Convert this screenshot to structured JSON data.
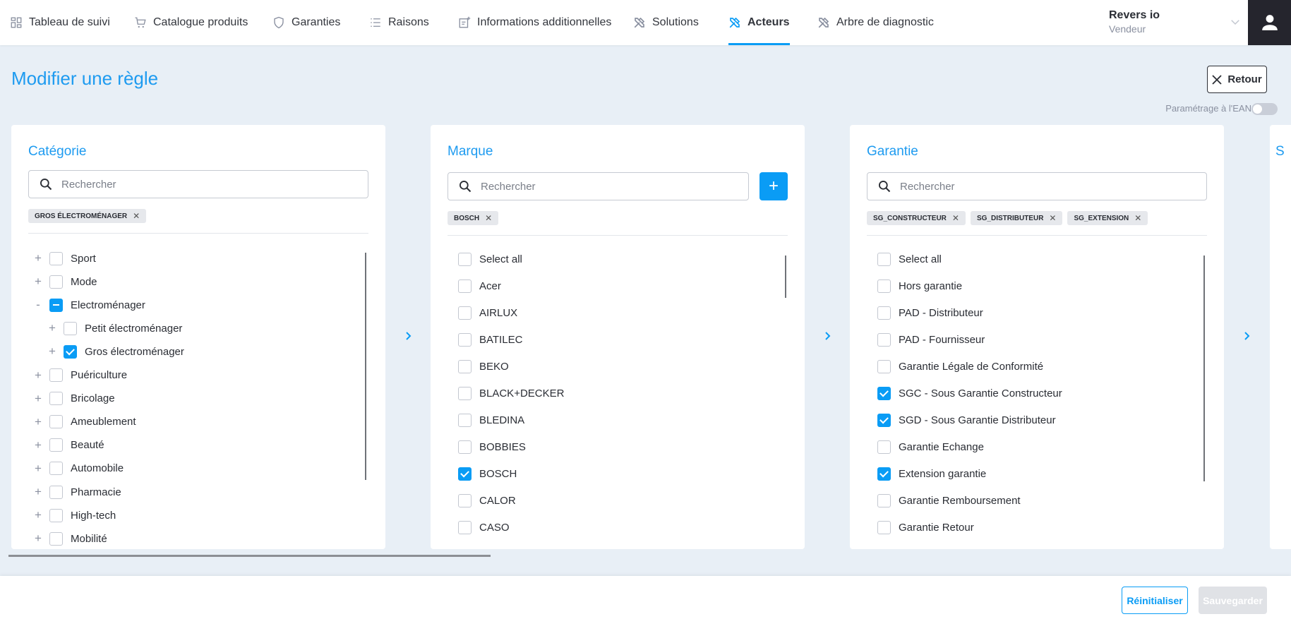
{
  "colors": {
    "accent": "#0a9cf5",
    "title": "#1e9bf0",
    "avatar_bg": "#25252d"
  },
  "nav": {
    "items": [
      {
        "label": "Tableau de suivi",
        "icon": "dashboard-icon"
      },
      {
        "label": "Catalogue produits",
        "icon": "cart-icon"
      },
      {
        "label": "Garanties",
        "icon": "shield-icon"
      },
      {
        "label": "Raisons",
        "icon": "list-icon"
      },
      {
        "label": "Informations additionnelles",
        "icon": "note-add-icon"
      },
      {
        "label": "Solutions",
        "icon": "tools-icon"
      },
      {
        "label": "Acteurs",
        "icon": "tools-icon",
        "active": true
      },
      {
        "label": "Arbre de diagnostic",
        "icon": "tools-icon"
      }
    ]
  },
  "user": {
    "name": "Revers io",
    "role": "Vendeur"
  },
  "page": {
    "title": "Modifier une règle",
    "back_label": "Retour",
    "ean_label": "Paramétrage à l'EAN",
    "ean_enabled": false
  },
  "cards": [
    {
      "title": "Catégorie",
      "search_placeholder": "Rechercher",
      "chips": [
        "GROS ÉLECTROMÉNAGER"
      ],
      "items": [
        {
          "label": "Sport",
          "state": "unchecked",
          "level": 0,
          "expander": "+"
        },
        {
          "label": "Mode",
          "state": "unchecked",
          "level": 0,
          "expander": "+"
        },
        {
          "label": "Electroménager",
          "state": "indeterminate",
          "level": 0,
          "expander": "-"
        },
        {
          "label": "Petit électroménager",
          "state": "unchecked",
          "level": 1,
          "expander": "+"
        },
        {
          "label": "Gros électroménager",
          "state": "checked",
          "level": 1,
          "expander": "+"
        },
        {
          "label": "Puériculture",
          "state": "unchecked",
          "level": 0,
          "expander": "+"
        },
        {
          "label": "Bricolage",
          "state": "unchecked",
          "level": 0,
          "expander": "+"
        },
        {
          "label": "Ameublement",
          "state": "unchecked",
          "level": 0,
          "expander": "+"
        },
        {
          "label": "Beauté",
          "state": "unchecked",
          "level": 0,
          "expander": "+"
        },
        {
          "label": "Automobile",
          "state": "unchecked",
          "level": 0,
          "expander": "+"
        },
        {
          "label": "Pharmacie",
          "state": "unchecked",
          "level": 0,
          "expander": "+"
        },
        {
          "label": "High-tech",
          "state": "unchecked",
          "level": 0,
          "expander": "+"
        },
        {
          "label": "Mobilité",
          "state": "unchecked",
          "level": 0,
          "expander": "+"
        }
      ]
    },
    {
      "title": "Marque",
      "search_placeholder": "Rechercher",
      "add_label": "+",
      "chips": [
        "BOSCH"
      ],
      "items": [
        {
          "label": "Select all",
          "state": "unchecked"
        },
        {
          "label": "Acer",
          "state": "unchecked"
        },
        {
          "label": "AIRLUX",
          "state": "unchecked"
        },
        {
          "label": "BATILEC",
          "state": "unchecked"
        },
        {
          "label": "BEKO",
          "state": "unchecked"
        },
        {
          "label": "BLACK+DECKER",
          "state": "unchecked"
        },
        {
          "label": "BLEDINA",
          "state": "unchecked"
        },
        {
          "label": "BOBBIES",
          "state": "unchecked"
        },
        {
          "label": "BOSCH",
          "state": "checked"
        },
        {
          "label": "CALOR",
          "state": "unchecked"
        },
        {
          "label": "CASO",
          "state": "unchecked"
        }
      ]
    },
    {
      "title": "Garantie",
      "search_placeholder": "Rechercher",
      "chips": [
        "SG_CONSTRUCTEUR",
        "SG_DISTRIBUTEUR",
        "SG_EXTENSION"
      ],
      "items": [
        {
          "label": "Select all",
          "state": "unchecked"
        },
        {
          "label": "Hors garantie",
          "state": "unchecked"
        },
        {
          "label": "PAD - Distributeur",
          "state": "unchecked"
        },
        {
          "label": "PAD - Fournisseur",
          "state": "unchecked"
        },
        {
          "label": "Garantie Légale de Conformité",
          "state": "unchecked"
        },
        {
          "label": "SGC - Sous Garantie Constructeur",
          "state": "checked"
        },
        {
          "label": "SGD - Sous Garantie Distributeur",
          "state": "checked"
        },
        {
          "label": "Garantie Echange",
          "state": "unchecked"
        },
        {
          "label": "Extension garantie",
          "state": "checked"
        },
        {
          "label": "Garantie Remboursement",
          "state": "unchecked"
        },
        {
          "label": "Garantie Retour",
          "state": "unchecked"
        }
      ]
    },
    {
      "title": "S"
    }
  ],
  "footer": {
    "reset_label": "Réinitialiser",
    "save_label": "Sauvegarder"
  }
}
